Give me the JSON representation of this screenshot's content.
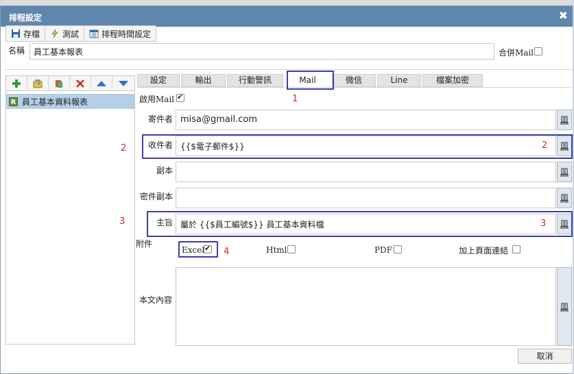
{
  "dialog": {
    "title": "排程設定",
    "close_symbol": "✖"
  },
  "toolbar": {
    "save_label": "存檔",
    "test_label": "測試",
    "schedule_label": "排程時間設定"
  },
  "name_row": {
    "label": "名稱",
    "value": "員工基本報表",
    "merge_label": "合併Mail",
    "merge_checked": false
  },
  "left_panel": {
    "tools": [
      "add-icon",
      "add-report-icon",
      "copy-icon",
      "delete-icon",
      "move-up-icon",
      "move-down-icon"
    ],
    "items": [
      {
        "badge": "R",
        "label": "員工基本資料報表"
      }
    ]
  },
  "tabs": [
    {
      "label": "設定"
    },
    {
      "label": "輸出"
    },
    {
      "label": "行動警訊"
    },
    {
      "label": "Mail",
      "active": true
    },
    {
      "label": "微信"
    },
    {
      "label": "Line"
    },
    {
      "label": "檔案加密"
    }
  ],
  "mail": {
    "enable_label": "啟用Mail",
    "enable_checked": true,
    "sender_label": "寄件者",
    "sender_value": "misa@gmail.com",
    "recipient_label": "收件者",
    "recipient_value": "{{$電子郵件$}}",
    "cc_label": "副本",
    "cc_value": "",
    "bcc_label": "密件副本",
    "bcc_value": "",
    "subject_label": "主旨",
    "subject_value": "屬於 {{$員工編號$}} 員工基本資料檔",
    "attach_label": "附件",
    "attachments": [
      {
        "label": "Excel",
        "checked": true
      },
      {
        "label": "Html",
        "checked": false
      },
      {
        "label": "PDF",
        "checked": false
      },
      {
        "label": "加上頁面連結",
        "checked": false
      }
    ],
    "body_label": "本文內容",
    "body_value": ""
  },
  "annotations": {
    "n1": "1",
    "n2_left": "2",
    "n2_right": "2",
    "n3_left": "3",
    "n3_right": "3",
    "n4": "4",
    "color": "#d42a2a",
    "box_color": "#3a3dad"
  },
  "footer": {
    "cancel_label": "取消"
  }
}
